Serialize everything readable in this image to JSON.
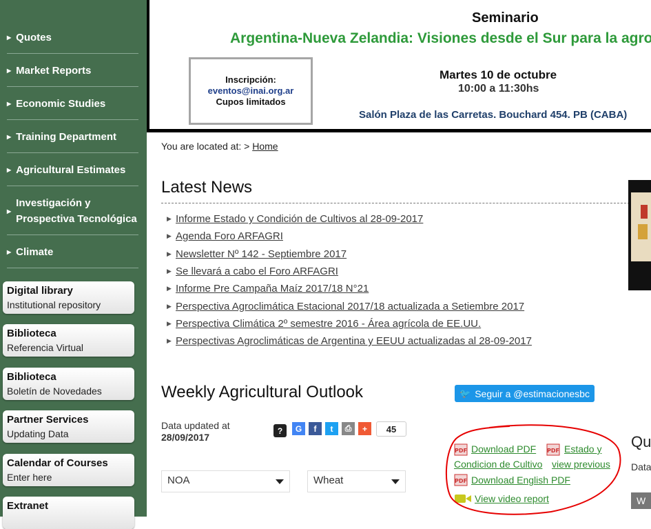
{
  "sidebar": {
    "nav": [
      {
        "label": "Quotes"
      },
      {
        "label": "Market Reports"
      },
      {
        "label": "Economic Studies"
      },
      {
        "label": "Training Department"
      },
      {
        "label": "Agricultural Estimates"
      },
      {
        "label_line1": "Investigación y",
        "label_line2": "Prospectiva Tecnológica"
      },
      {
        "label": "Climate"
      }
    ],
    "buttons": [
      {
        "title": "Digital library",
        "subtitle": "Institutional repository"
      },
      {
        "title": "Biblioteca",
        "subtitle": "Referencia Virtual"
      },
      {
        "title": "Biblioteca",
        "subtitle": "Boletín de Novedades"
      },
      {
        "title": "Partner Services",
        "subtitle": "Updating Data"
      },
      {
        "title": "Calendar of Courses",
        "subtitle": "Enter here"
      },
      {
        "title": "Extranet",
        "subtitle": ""
      }
    ]
  },
  "banner": {
    "title": "Seminario",
    "subtitle": "Argentina-Nueva Zelandia: Visiones desde el Sur para la agroindustria",
    "registration": {
      "label": "Inscripción:",
      "email": "eventos@inai.org.ar",
      "note": "Cupos limitados"
    },
    "date": "Martes 10 de octubre",
    "time": "10:00 a 11:30hs",
    "venue": "Salón Plaza de las Carretas. Bouchard 454. PB (CABA)"
  },
  "breadcrumb": {
    "prefix": "You are located at: >",
    "home": "Home"
  },
  "latest_news": {
    "heading": "Latest News",
    "items": [
      "Informe Estado y Condición de Cultivos al 28-09-2017",
      "Agenda Foro ARFAGRI",
      "Newsletter Nº 142 - Septiembre 2017",
      "Se llevará a cabo el Foro ARFAGRI",
      "Informe Pre Campaña Maíz 2017/18 N°21",
      "Perspectiva Agroclimática Estacional 2017/18 actualizada a Setiembre 2017",
      "Perspectiva Climática 2º semestre 2016 - Área agrícola de EE.UU.",
      "Perspectivas Agroclimáticas de Argentina y EEUU actualizadas al 28-09-2017"
    ]
  },
  "weekly": {
    "heading": "Weekly Agricultural Outlook",
    "updated_label": "Data updated at",
    "updated_date": "28/09/2017",
    "share_count": "45",
    "twitter_button": "Seguir a @estimacionesbc",
    "region_select": "NOA",
    "crop_select": "Wheat",
    "downloads": {
      "pdf": "Download PDF",
      "condicion": "Condicion de Cultivo",
      "estado": "Estado y",
      "view_previous": "view previous",
      "english_pdf": "Download English PDF",
      "video": "View video report"
    }
  },
  "right_cut": {
    "heading_fragment": "Qu",
    "data_fragment": "Data",
    "button_fragment": "W"
  },
  "colors": {
    "sidebar": "#456e4e",
    "banner_title_green": "#2e9a3a",
    "twitter_blue": "#1c96e8",
    "annotation_red": "#e60000"
  }
}
